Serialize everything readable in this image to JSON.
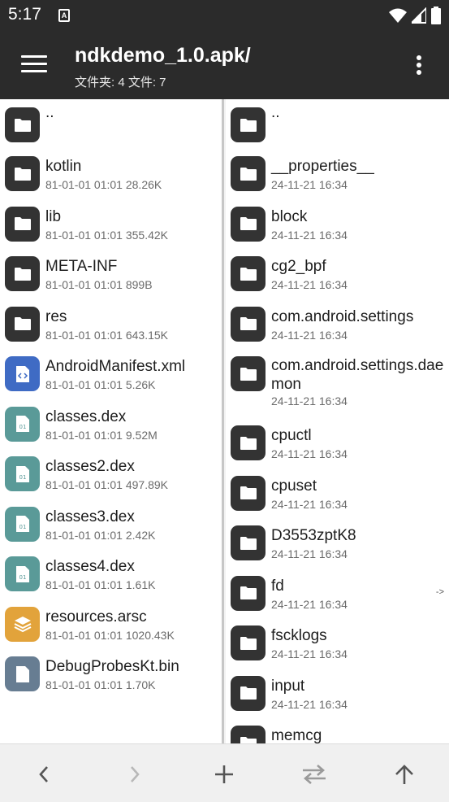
{
  "status": {
    "time": "5:17",
    "notif_letter": "A"
  },
  "toolbar": {
    "title": "ndkdemo_1.0.apk/",
    "subtitle": "文件夹: 4  文件: 7"
  },
  "left": {
    "up": "..",
    "items": [
      {
        "name": "kotlin",
        "meta": "81-01-01 01:01  28.26K",
        "icon": "folder-icon"
      },
      {
        "name": "lib",
        "meta": "81-01-01 01:01  355.42K",
        "icon": "folder-icon"
      },
      {
        "name": "META-INF",
        "meta": "81-01-01 01:01  899B",
        "icon": "folder-icon"
      },
      {
        "name": "res",
        "meta": "81-01-01 01:01  643.15K",
        "icon": "folder-icon"
      },
      {
        "name": "AndroidManifest.xml",
        "meta": "81-01-01 01:01  5.26K",
        "icon": "xml-file-icon"
      },
      {
        "name": "classes.dex",
        "meta": "81-01-01 01:01  9.52M",
        "icon": "dex-file-icon"
      },
      {
        "name": "classes2.dex",
        "meta": "81-01-01 01:01  497.89K",
        "icon": "dex-file-icon"
      },
      {
        "name": "classes3.dex",
        "meta": "81-01-01 01:01  2.42K",
        "icon": "dex-file-icon"
      },
      {
        "name": "classes4.dex",
        "meta": "81-01-01 01:01  1.61K",
        "icon": "dex-file-icon"
      },
      {
        "name": "resources.arsc",
        "meta": "81-01-01 01:01  1020.43K",
        "icon": "layers-file-icon"
      },
      {
        "name": "DebugProbesKt.bin",
        "meta": "81-01-01 01:01  1.70K",
        "icon": "generic-file-icon"
      }
    ]
  },
  "right": {
    "up": "..",
    "items": [
      {
        "name": "__properties__",
        "meta": "24-11-21 16:34"
      },
      {
        "name": "block",
        "meta": "24-11-21 16:34"
      },
      {
        "name": "cg2_bpf",
        "meta": "24-11-21 16:34"
      },
      {
        "name": "com.android.settings",
        "meta": "24-11-21 16:34"
      },
      {
        "name": "com.android.settings.daemon",
        "meta": "24-11-21 16:34"
      },
      {
        "name": "cpuctl",
        "meta": "24-11-21 16:34"
      },
      {
        "name": "cpuset",
        "meta": "24-11-21 16:34"
      },
      {
        "name": "D3553zptK8",
        "meta": "24-11-21 16:34"
      },
      {
        "name": "fd",
        "meta": "24-11-21 16:34",
        "link": "->"
      },
      {
        "name": "fscklogs",
        "meta": "24-11-21 16:34"
      },
      {
        "name": "input",
        "meta": "24-11-21 16:34"
      },
      {
        "name": "memcg",
        "meta": ""
      }
    ]
  },
  "bottom": [
    "back-icon",
    "forward-icon",
    "add-icon",
    "swap-icon",
    "up-arrow-icon"
  ]
}
